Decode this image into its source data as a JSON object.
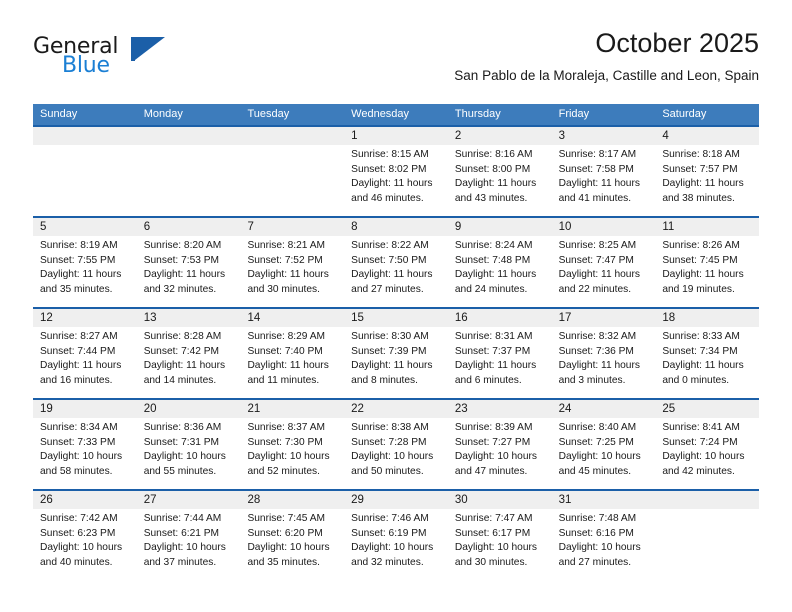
{
  "brand": {
    "name_top": "General",
    "name_bottom": "Blue",
    "logo_icon": "flag-triangle-icon",
    "accent_color": "#1b5fa8",
    "blue_text_color": "#1b7fd4"
  },
  "header": {
    "title": "October 2025",
    "subtitle": "San Pablo de la Moraleja, Castille and Leon, Spain"
  },
  "theme": {
    "header_row_color": "#3d7cbc",
    "week_separator_color": "#1b5fa8",
    "date_band_color": "#efefef"
  },
  "calendar": {
    "weekday_headers": [
      "Sunday",
      "Monday",
      "Tuesday",
      "Wednesday",
      "Thursday",
      "Friday",
      "Saturday"
    ],
    "weeks": [
      {
        "days": [
          {
            "date": "",
            "detail": ""
          },
          {
            "date": "",
            "detail": ""
          },
          {
            "date": "",
            "detail": ""
          },
          {
            "date": "1",
            "detail": "Sunrise: 8:15 AM\nSunset: 8:02 PM\nDaylight: 11 hours\nand 46 minutes."
          },
          {
            "date": "2",
            "detail": "Sunrise: 8:16 AM\nSunset: 8:00 PM\nDaylight: 11 hours\nand 43 minutes."
          },
          {
            "date": "3",
            "detail": "Sunrise: 8:17 AM\nSunset: 7:58 PM\nDaylight: 11 hours\nand 41 minutes."
          },
          {
            "date": "4",
            "detail": "Sunrise: 8:18 AM\nSunset: 7:57 PM\nDaylight: 11 hours\nand 38 minutes."
          }
        ]
      },
      {
        "days": [
          {
            "date": "5",
            "detail": "Sunrise: 8:19 AM\nSunset: 7:55 PM\nDaylight: 11 hours\nand 35 minutes."
          },
          {
            "date": "6",
            "detail": "Sunrise: 8:20 AM\nSunset: 7:53 PM\nDaylight: 11 hours\nand 32 minutes."
          },
          {
            "date": "7",
            "detail": "Sunrise: 8:21 AM\nSunset: 7:52 PM\nDaylight: 11 hours\nand 30 minutes."
          },
          {
            "date": "8",
            "detail": "Sunrise: 8:22 AM\nSunset: 7:50 PM\nDaylight: 11 hours\nand 27 minutes."
          },
          {
            "date": "9",
            "detail": "Sunrise: 8:24 AM\nSunset: 7:48 PM\nDaylight: 11 hours\nand 24 minutes."
          },
          {
            "date": "10",
            "detail": "Sunrise: 8:25 AM\nSunset: 7:47 PM\nDaylight: 11 hours\nand 22 minutes."
          },
          {
            "date": "11",
            "detail": "Sunrise: 8:26 AM\nSunset: 7:45 PM\nDaylight: 11 hours\nand 19 minutes."
          }
        ]
      },
      {
        "days": [
          {
            "date": "12",
            "detail": "Sunrise: 8:27 AM\nSunset: 7:44 PM\nDaylight: 11 hours\nand 16 minutes."
          },
          {
            "date": "13",
            "detail": "Sunrise: 8:28 AM\nSunset: 7:42 PM\nDaylight: 11 hours\nand 14 minutes."
          },
          {
            "date": "14",
            "detail": "Sunrise: 8:29 AM\nSunset: 7:40 PM\nDaylight: 11 hours\nand 11 minutes."
          },
          {
            "date": "15",
            "detail": "Sunrise: 8:30 AM\nSunset: 7:39 PM\nDaylight: 11 hours\nand 8 minutes."
          },
          {
            "date": "16",
            "detail": "Sunrise: 8:31 AM\nSunset: 7:37 PM\nDaylight: 11 hours\nand 6 minutes."
          },
          {
            "date": "17",
            "detail": "Sunrise: 8:32 AM\nSunset: 7:36 PM\nDaylight: 11 hours\nand 3 minutes."
          },
          {
            "date": "18",
            "detail": "Sunrise: 8:33 AM\nSunset: 7:34 PM\nDaylight: 11 hours\nand 0 minutes."
          }
        ]
      },
      {
        "days": [
          {
            "date": "19",
            "detail": "Sunrise: 8:34 AM\nSunset: 7:33 PM\nDaylight: 10 hours\nand 58 minutes."
          },
          {
            "date": "20",
            "detail": "Sunrise: 8:36 AM\nSunset: 7:31 PM\nDaylight: 10 hours\nand 55 minutes."
          },
          {
            "date": "21",
            "detail": "Sunrise: 8:37 AM\nSunset: 7:30 PM\nDaylight: 10 hours\nand 52 minutes."
          },
          {
            "date": "22",
            "detail": "Sunrise: 8:38 AM\nSunset: 7:28 PM\nDaylight: 10 hours\nand 50 minutes."
          },
          {
            "date": "23",
            "detail": "Sunrise: 8:39 AM\nSunset: 7:27 PM\nDaylight: 10 hours\nand 47 minutes."
          },
          {
            "date": "24",
            "detail": "Sunrise: 8:40 AM\nSunset: 7:25 PM\nDaylight: 10 hours\nand 45 minutes."
          },
          {
            "date": "25",
            "detail": "Sunrise: 8:41 AM\nSunset: 7:24 PM\nDaylight: 10 hours\nand 42 minutes."
          }
        ]
      },
      {
        "days": [
          {
            "date": "26",
            "detail": "Sunrise: 7:42 AM\nSunset: 6:23 PM\nDaylight: 10 hours\nand 40 minutes."
          },
          {
            "date": "27",
            "detail": "Sunrise: 7:44 AM\nSunset: 6:21 PM\nDaylight: 10 hours\nand 37 minutes."
          },
          {
            "date": "28",
            "detail": "Sunrise: 7:45 AM\nSunset: 6:20 PM\nDaylight: 10 hours\nand 35 minutes."
          },
          {
            "date": "29",
            "detail": "Sunrise: 7:46 AM\nSunset: 6:19 PM\nDaylight: 10 hours\nand 32 minutes."
          },
          {
            "date": "30",
            "detail": "Sunrise: 7:47 AM\nSunset: 6:17 PM\nDaylight: 10 hours\nand 30 minutes."
          },
          {
            "date": "31",
            "detail": "Sunrise: 7:48 AM\nSunset: 6:16 PM\nDaylight: 10 hours\nand 27 minutes."
          },
          {
            "date": "",
            "detail": ""
          }
        ]
      }
    ]
  }
}
